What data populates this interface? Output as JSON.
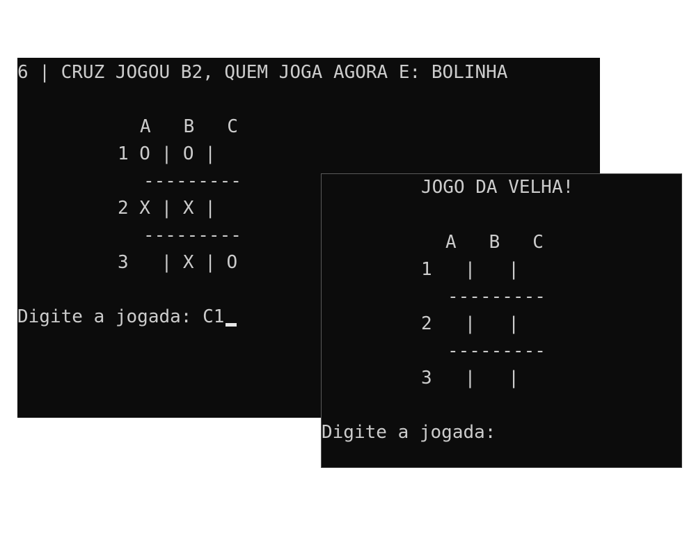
{
  "back_console": {
    "status_line": "6 | CRUZ JOGOU B2, QUEM JOGA AGORA E: BOLINHA",
    "board": {
      "column_header": "A   B   C",
      "rows": [
        "1 O | O |",
        "2 X | X |",
        "3   | X | O"
      ],
      "separator": "---------"
    },
    "prompt": "Digite a jogada: ",
    "input_value": "C1"
  },
  "front_console": {
    "title": "JOGO DA VELHA!",
    "board": {
      "column_header": "A   B   C",
      "rows": [
        "1   |   |",
        "2   |   |",
        "3   |   |"
      ],
      "separator": "---------"
    },
    "prompt": "Digite a jogada:"
  },
  "colors": {
    "console_background": "#0c0c0c",
    "console_text": "#cccccc",
    "page_background": "#ffffff"
  }
}
